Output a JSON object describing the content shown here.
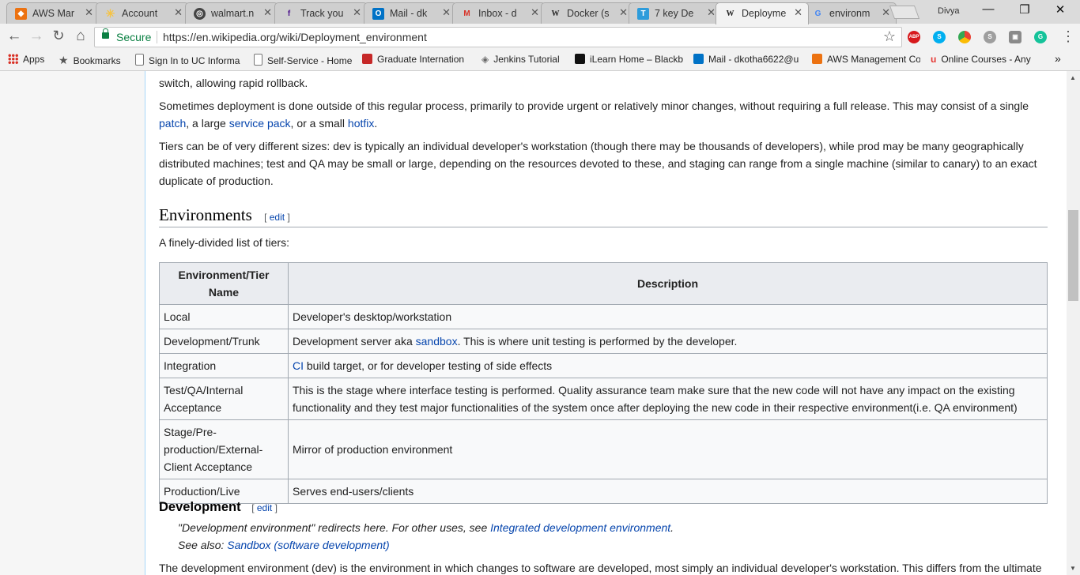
{
  "browser": {
    "tabs": [
      {
        "title": "AWS Mar",
        "color": "#ec7211",
        "glyph": "◆"
      },
      {
        "title": "Account",
        "color": "#f6c342",
        "glyph": "✳"
      },
      {
        "title": "walmart.n",
        "color": "#444444",
        "glyph": "◎"
      },
      {
        "title": "Track you",
        "color": "#4d148c",
        "glyph": "f"
      },
      {
        "title": "Mail - dk",
        "color": "#0072c6",
        "glyph": "O"
      },
      {
        "title": "Inbox - d",
        "color": "#d93025",
        "glyph": "M"
      },
      {
        "title": "Docker (s",
        "color": "#ffffff",
        "glyph": "W"
      },
      {
        "title": "7 key De",
        "color": "#2d9cdb",
        "glyph": "T"
      },
      {
        "title": "Deployme",
        "color": "#ffffff",
        "glyph": "W"
      },
      {
        "title": "environm",
        "color": "#4285f4",
        "glyph": "G"
      }
    ],
    "profile": "Divya",
    "window_controls": {
      "minimize": "—",
      "maximize": "❐",
      "close": "✕"
    },
    "secure_label": "Secure",
    "url": "https://en.wikipedia.org/wiki/Deployment_environment",
    "extensions": [
      {
        "name": "abp-icon",
        "label": "ABP",
        "color": "#d7191c"
      },
      {
        "name": "skype-icon",
        "label": "S",
        "color": "#00aff0"
      },
      {
        "name": "chrome-color-icon",
        "label": "",
        "color": "#f4b400"
      },
      {
        "name": "skype-gray-icon",
        "label": "S",
        "color": "#9e9e9e"
      },
      {
        "name": "extension-gray-icon",
        "label": "▣",
        "color": "#8a8a8a"
      },
      {
        "name": "grammarly-icon",
        "label": "G",
        "color": "#15c39a"
      }
    ],
    "bookmarks": [
      {
        "label": "Apps",
        "color": "#d93025"
      },
      {
        "label": "Bookmarks",
        "color": "#555555"
      },
      {
        "label": "Sign In to UC Informa",
        "color": "#ffffff"
      },
      {
        "label": "Self-Service - Home",
        "color": "#ffffff"
      },
      {
        "label": "Graduate Internation",
        "color": "#c62828"
      },
      {
        "label": "Jenkins Tutorial",
        "color": "#777777"
      },
      {
        "label": "iLearn Home – Blackb",
        "color": "#111111"
      },
      {
        "label": "Mail - dkotha6622@u",
        "color": "#0072c6"
      },
      {
        "label": "AWS Management Co",
        "color": "#ec7211"
      },
      {
        "label": "Online Courses - Any",
        "color": "#e53935"
      }
    ],
    "more_bookmarks": "»"
  },
  "article": {
    "p0": "switch, allowing rapid rollback.",
    "p1": {
      "text1": "Sometimes deployment is done outside of this regular process, primarily to provide urgent or relatively minor changes, without requiring a full release. This may consist of a single ",
      "link1": "patch",
      "text2": ", a large ",
      "link2": "service pack",
      "text3": ", or a small ",
      "link3": "hotfix",
      "text4": "."
    },
    "p2": "Tiers can be of very different sizes: dev is typically an individual developer's workstation (though there may be thousands of developers), while prod may be many geographically distributed machines; test and QA may be small or large, depending on the resources devoted to these, and staging can range from a single machine (similar to canary) to an exact duplicate of production.",
    "environments_heading": "Environments",
    "edit_open": "[ ",
    "edit_label": "edit",
    "edit_close": " ]",
    "list_intro": "A finely-divided list of tiers:",
    "table": {
      "col1": "Environment/Tier Name",
      "col2": "Description",
      "rows": [
        {
          "name": "Local",
          "desc": "Developer's desktop/workstation"
        },
        {
          "name": "Development/Trunk",
          "pre": "Development server aka ",
          "link": "sandbox",
          "post": ". This is where unit testing is performed by the developer."
        },
        {
          "name": "Integration",
          "pre": "",
          "link": "CI",
          "post": " build target, or for developer testing of side effects"
        },
        {
          "name": "Test/QA/Internal Acceptance",
          "desc": "This is the stage where interface testing is performed. Quality assurance team make sure that the new code will not have any impact on the existing functionality and they test major functionalities of the system once after deploying the new code in their respective environment(i.e. QA environment)"
        },
        {
          "name": "Stage/Pre-production/External-Client Acceptance",
          "desc": "Mirror of production environment"
        },
        {
          "name": "Production/Live",
          "desc": "Serves end-users/clients"
        }
      ]
    },
    "development_heading": "Development",
    "hatnote1_text": "\"Development environment\" redirects here. For other uses, see ",
    "hatnote1_link": "Integrated development environment",
    "hatnote1_end": ".",
    "hatnote2_text": "See also: ",
    "hatnote2_link": "Sandbox (software development)",
    "p3": "The development environment (dev) is the environment in which changes to software are developed, most simply an individual developer's workstation. This differs from the ultimate"
  }
}
